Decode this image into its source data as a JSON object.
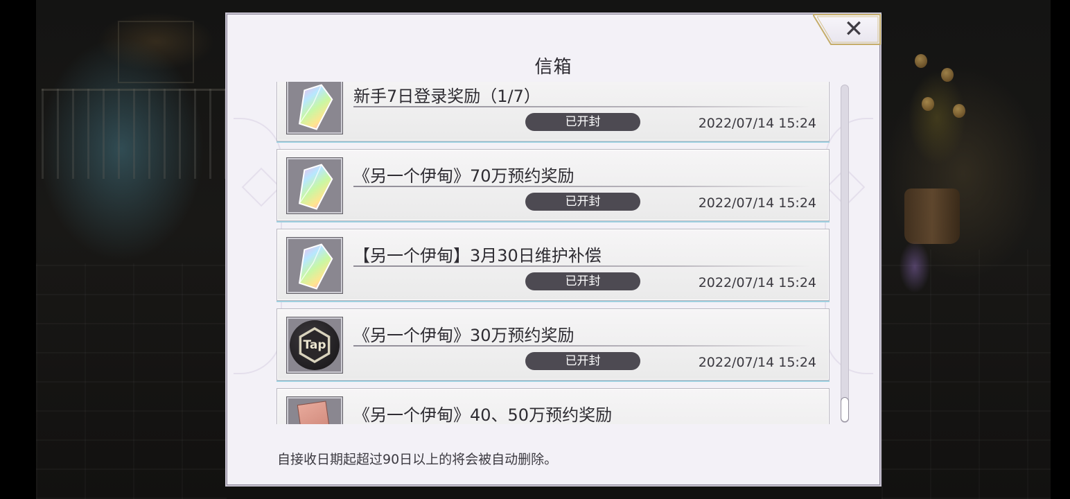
{
  "dialog": {
    "title": "信箱",
    "close_glyph": "✕",
    "footer_note": "自接收日期起超过90日以上的将会被自动删除。"
  },
  "mails": [
    {
      "subject": "新手7日登录奖励（1/7）",
      "status": "已开封",
      "date": "2022/07/14 15:24",
      "icon": "rainbow-crystal-icon"
    },
    {
      "subject": "《另一个伊甸》70万预约奖励",
      "status": "已开封",
      "date": "2022/07/14 15:24",
      "icon": "rainbow-crystal-icon"
    },
    {
      "subject": "【另一个伊甸】3月30日维护补偿",
      "status": "已开封",
      "date": "2022/07/14 15:24",
      "icon": "rainbow-crystal-icon"
    },
    {
      "subject": "《另一个伊甸》30万预约奖励",
      "status": "已开封",
      "date": "2022/07/14 15:24",
      "icon": "taptap-icon"
    },
    {
      "subject": "《另一个伊甸》40、50万预约奖励",
      "status": "",
      "date": "",
      "icon": "ticket-icon"
    }
  ],
  "tap_label": "Tap",
  "colors": {
    "dialog_bg": "#f3f1f7",
    "status_pill": "#4d4a52",
    "item_glow": "#9fd0e0"
  }
}
